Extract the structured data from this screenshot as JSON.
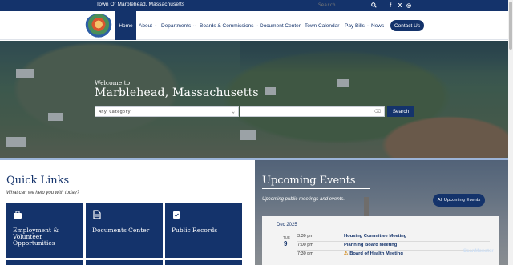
{
  "topbar": {
    "town_name": "Town Of Marblehead, Massachusetts",
    "search_placeholder": "Search ...",
    "social": [
      "f",
      "X",
      "◎"
    ]
  },
  "nav": {
    "items": [
      {
        "label": "Home",
        "dropdown": false
      },
      {
        "label": "About",
        "dropdown": true
      },
      {
        "label": "Departments",
        "dropdown": true
      },
      {
        "label": "Boards & Commissions",
        "dropdown": true
      },
      {
        "label": "Document Center",
        "dropdown": false
      },
      {
        "label": "Town Calendar",
        "dropdown": false
      },
      {
        "label": "Pay Bills",
        "dropdown": true
      },
      {
        "label": "News",
        "dropdown": false
      }
    ],
    "contact_label": "Contact Us"
  },
  "hero": {
    "welcome": "Welcome to",
    "city": "Marblehead, Massachusetts",
    "category_selected": "Any Category",
    "search_button": "Search"
  },
  "quick_links": {
    "heading": "Quick Links",
    "subheading": "What can we help you with today?",
    "tiles": [
      {
        "label": "Employment & Volunteer Opportunities",
        "icon": "briefcase-icon"
      },
      {
        "label": "Documents Center",
        "icon": "document-icon"
      },
      {
        "label": "Public Records",
        "icon": "clipboard-check-icon"
      }
    ]
  },
  "events": {
    "heading": "Upcoming Events",
    "subheading": "Upcoming public meetings and events.",
    "all_button": "All Upcoming Events",
    "month": "Dec 2025",
    "dow": "TUE",
    "day": "9",
    "items": [
      {
        "time": "3:30 pm",
        "title": "Housing Committee Meeting",
        "alert": false
      },
      {
        "time": "7:00 pm",
        "title": "Planning Board Meeting",
        "alert": false
      },
      {
        "time": "7:30 pm",
        "title": "Board of Health Meeting",
        "alert": true
      }
    ]
  },
  "badge": "ScanMonster",
  "colors": {
    "primary": "#14336b",
    "accent": "#9cb4d8"
  }
}
